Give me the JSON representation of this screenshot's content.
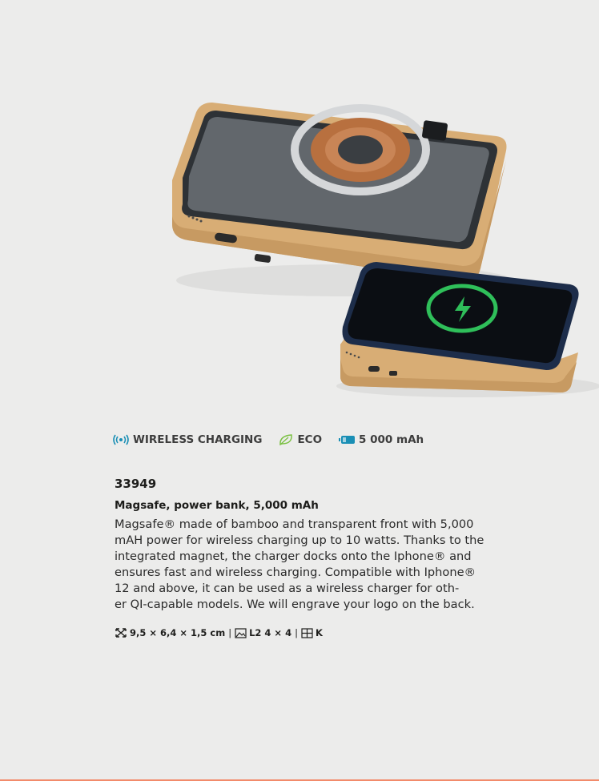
{
  "features": [
    {
      "icon": "wireless-icon",
      "label": "WIRELESS CHARGING",
      "color": "#1a8fb5"
    },
    {
      "icon": "leaf-icon",
      "label": "ECO",
      "color": "#7bc043"
    },
    {
      "icon": "battery-icon",
      "label": "5 000 mAh",
      "color": "#1a8fb5"
    }
  ],
  "product": {
    "sku": "33949",
    "title": "Magsafe, power bank, 5,000 mAh",
    "description_lines": [
      "Magsafe® made of bamboo and transparent front with 5,000",
      "mAH power for wireless charging up to 10 watts. Thanks to the",
      "integrated magnet, the charger docks onto the Iphone® and",
      "ensures fast and wireless charging. Compatible with Iphone®",
      "12 and above, it can be used as a wireless charger for oth-",
      "er QI-capable models. We will engrave your logo on the back."
    ],
    "dimensions": "9,5 × 6,4 × 1,5 cm",
    "print_area": "L2 4 × 4",
    "carton": "K"
  },
  "colors": {
    "background": "#ececeb",
    "accent_line": "#f28b6b",
    "bamboo": "#d9b07a",
    "charge_ring": "#2fbf5a"
  }
}
